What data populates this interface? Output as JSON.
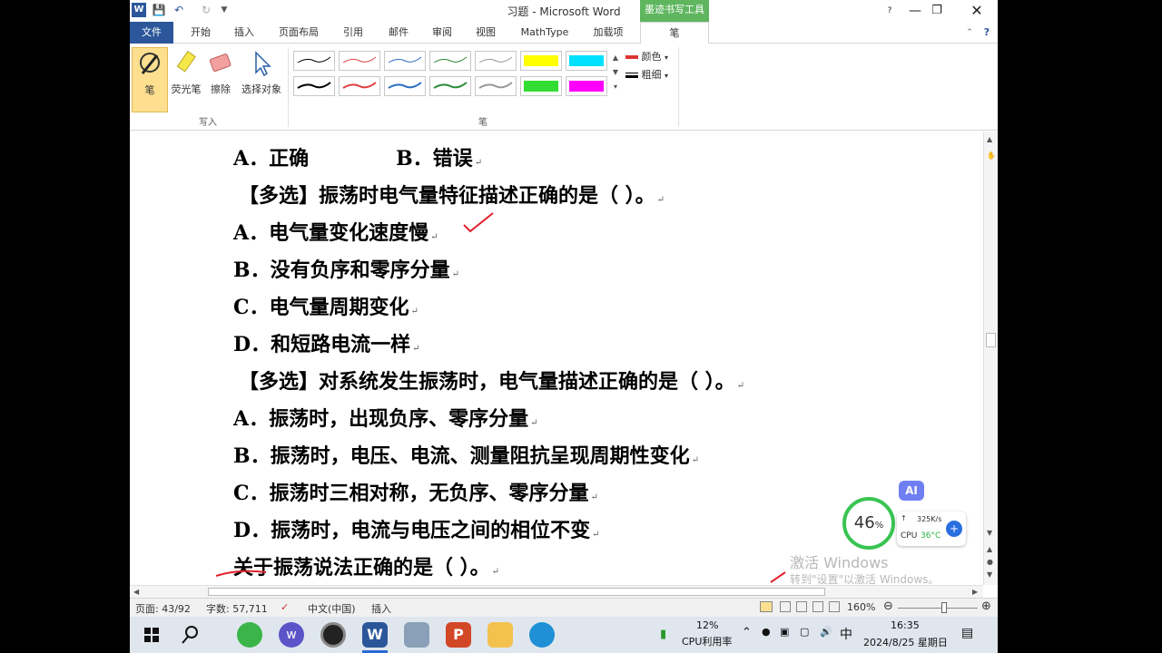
{
  "window": {
    "title": "习题 - Microsoft Word",
    "context_tab_title": "墨迹书写工具"
  },
  "tabs": [
    "文件",
    "开始",
    "插入",
    "页面布局",
    "引用",
    "邮件",
    "审阅",
    "视图",
    "MathType",
    "加载项",
    "笔"
  ],
  "ribbon": {
    "write_buttons": {
      "pen": "笔",
      "highlighter": "荧光笔",
      "eraser": "擦除",
      "select": "选择对象"
    },
    "group_write": "写入",
    "group_pen": "笔",
    "color_label": "颜色",
    "thickness_label": "粗细",
    "pen_colors_row1": [
      "#000000",
      "#e04040",
      "#2a6fc0",
      "#2a8a3a",
      "#999999",
      "#ffff00",
      "#00e0ff"
    ],
    "pen_colors_row2": [
      "#000000",
      "#e04040",
      "#2a6fc0",
      "#2a8a3a",
      "#999999",
      "#33dd33",
      "#ff00ff"
    ]
  },
  "document": {
    "lines": [
      {
        "a": "A．正确",
        "b": "B．错误"
      },
      "【多选】振荡时电气量特征描述正确的是（   ）。",
      "A．电气量变化速度慢",
      "B．没有负序和零序分量",
      "C．电气量周期变化",
      "D．和短路电流一样",
      "【多选】对系统发生振荡时，电气量描述正确的是（   ）。",
      "A．振荡时，出现负序、零序分量",
      "B．振荡时，电压、电流、测量阻抗呈现周期性变化",
      "C．振荡时三相对称，无负序、零序分量",
      "D．振荡时，电流与电压之间的相位不变",
      "关于振荡说法正确的是（   ）。"
    ]
  },
  "status": {
    "page": "页面: 43/92",
    "words": "字数: 57,711",
    "language": "中文(中国)",
    "mode": "插入",
    "zoom": "160%"
  },
  "overlay": {
    "ai_badge": "AI",
    "cpu_percent": "46",
    "percent_sign": "%",
    "net_speed": "325K/s",
    "cpu_temp_label": "CPU",
    "cpu_temp": "36°C",
    "watermark_title": "激活 Windows",
    "watermark_sub": "转到\"设置\"以激活 Windows。"
  },
  "taskbar": {
    "cpu_usage": "12%",
    "cpu_usage_label": "CPU利用率",
    "ime": "中",
    "time": "16:35",
    "date": "2024/8/25 星期日"
  }
}
